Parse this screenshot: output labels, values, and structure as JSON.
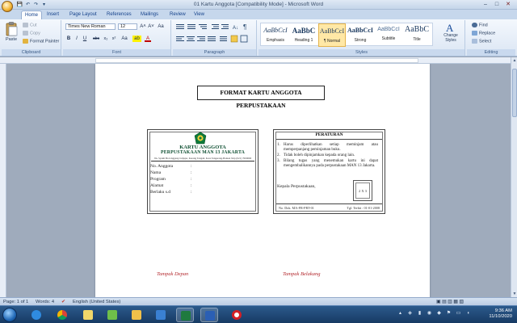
{
  "window": {
    "title": "01 Kartu Anggota [Compatibility Mode] - Microsoft Word",
    "minimize": "–",
    "maximize": "□",
    "close": "✕"
  },
  "quick_access": [
    "💾",
    "↶",
    "↷",
    "▾"
  ],
  "tabs": [
    "Home",
    "Insert",
    "Page Layout",
    "References",
    "Mailings",
    "Review",
    "View"
  ],
  "active_tab": "Home",
  "ribbon": {
    "clipboard": {
      "label": "Clipboard",
      "paste": "Paste",
      "cut": "Cut",
      "copy": "Copy",
      "format_painter": "Format Painter"
    },
    "font": {
      "label": "Font",
      "font_name": "Times New Roman",
      "font_size": "12",
      "grow": "A˄",
      "shrink": "A˅",
      "clear": "Aa",
      "bold": "B",
      "italic": "I",
      "underline": "U",
      "strike": "abc",
      "sub": "x₂",
      "sup": "x²",
      "case": "Aa",
      "highlight": "ab",
      "color": "A"
    },
    "paragraph": {
      "label": "Paragraph"
    },
    "styles": {
      "label": "Styles",
      "items": [
        {
          "preview": "AaBbCcI",
          "name": "Emphasis"
        },
        {
          "preview": "AaBbC",
          "name": "Heading 1"
        },
        {
          "preview": "AaBbCcI",
          "name": "¶ Normal"
        },
        {
          "preview": "AaBbCcI",
          "name": "Strong"
        },
        {
          "preview": "AaBbCcI",
          "name": "Subtitle"
        },
        {
          "preview": "AaBbC",
          "name": "Title"
        }
      ],
      "change_styles": "Change Styles"
    },
    "editing": {
      "label": "Editing",
      "find": "Find",
      "replace": "Replace",
      "select": "Select"
    }
  },
  "document": {
    "format_title": "FORMAT KARTU ANGGOTA PERPUSTAKAAN",
    "front": {
      "title": "KARTU ANGGOTA",
      "subtitle": "PERPUSTAKAAN MAN 13 JAKARTA",
      "address": "Jln. Syekh Ba Linggang Jatijajar, Karang Tengah, Kota Tangerang-Banten Telp (021) 7000000",
      "fields": [
        "No. Anggota",
        "Nama",
        "Program",
        "Alamat",
        "Berlaku s.d"
      ],
      "colon": ":"
    },
    "back": {
      "title": "PERATURAN",
      "rules": [
        {
          "n": "1.",
          "text": "Harus diperlihatkan setiap meminjam atau memperpanjang peminjaman buku."
        },
        {
          "n": "2.",
          "text": "Tidak boleh dipinjamkan kepada orang lain."
        },
        {
          "n": "3.",
          "text": "Bilang tugas yang menemukan kartu ini dapat mengembalikannya pada perpustakaan MAN 13 Jakarta."
        }
      ],
      "signatory": "Kepala Perpustakaan,",
      "photo": "2 X 3",
      "doc_no": "No. Dok.  MA-FR-PRT-01",
      "issue_date": "Tgl. Terbit : 01-01-2008"
    },
    "caption_front": "Tampak Depan",
    "caption_back": "Tampak Belakang"
  },
  "status": {
    "page": "Page: 1 of 1",
    "words": "Words: 4",
    "language": "English (United States)"
  },
  "taskbar": {
    "time": "9:36 AM",
    "date": "11/10/2020"
  },
  "colors": {
    "accent": "#15428b",
    "logo_green": "#0e7a3a",
    "caption_red": "#b3282d"
  }
}
